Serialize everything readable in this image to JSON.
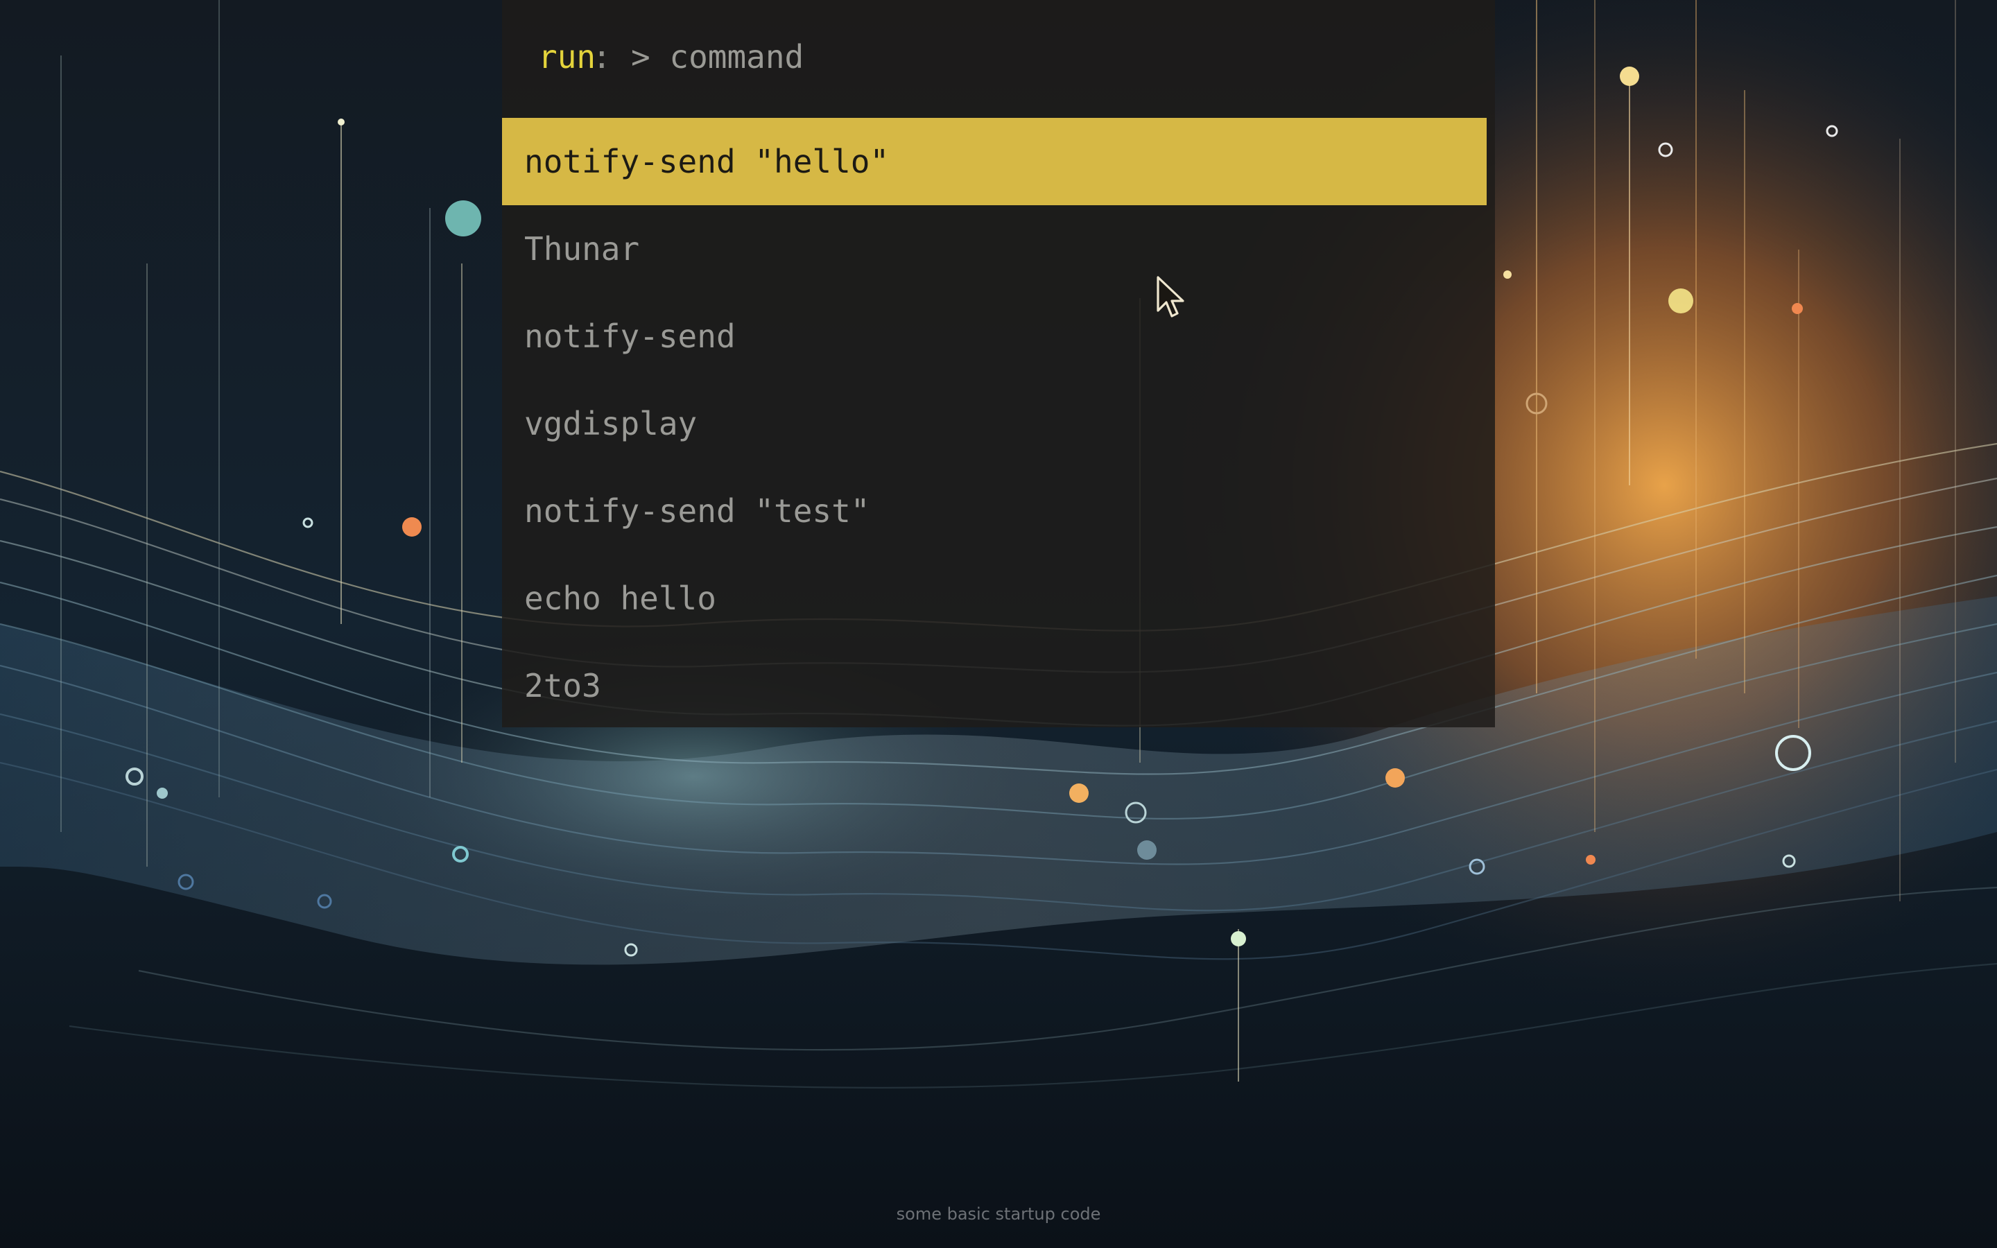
{
  "launcher": {
    "prompt_label": "run",
    "prompt_separator": ":",
    "input_placeholder": "> command",
    "results": [
      {
        "label": "notify-send \"hello\"",
        "selected": true
      },
      {
        "label": "Thunar",
        "selected": false
      },
      {
        "label": "notify-send",
        "selected": false
      },
      {
        "label": "vgdisplay",
        "selected": false
      },
      {
        "label": "notify-send \"test\"",
        "selected": false
      },
      {
        "label": "echo hello",
        "selected": false
      },
      {
        "label": "2to3",
        "selected": false
      }
    ]
  },
  "desktop": {
    "footer_text": "some basic startup code"
  },
  "colors": {
    "accent": "#d6b845",
    "prompt_label": "#e3d33b",
    "item_text": "#9a9a96",
    "panel_bg": "#1e1c1a"
  },
  "icons": {
    "cursor": "arrow-cursor-icon"
  }
}
